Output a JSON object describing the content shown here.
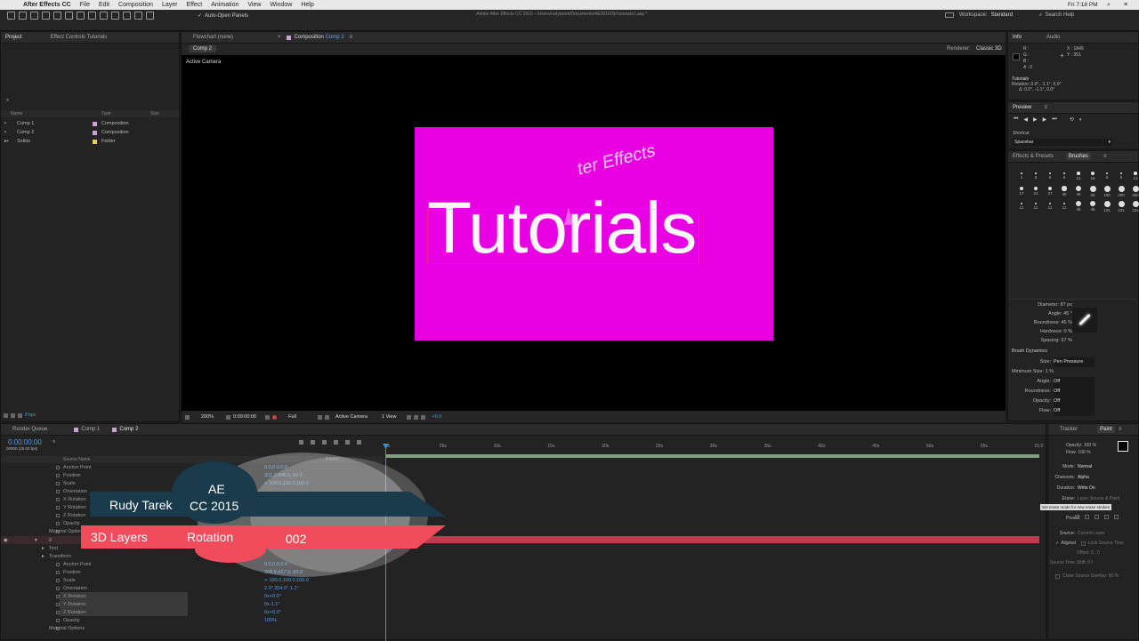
{
  "menubar": {
    "items": [
      "After Effects CC",
      "File",
      "Edit",
      "Composition",
      "Layer",
      "Effect",
      "Animation",
      "View",
      "Window",
      "Help"
    ],
    "clock": "Fri 7:18 PM"
  },
  "toolbar": {
    "auto_open": "Auto-Open Panels",
    "title": "Adobe After Effects CC 2015 - /Users/rudytarek/Documents/AE2016/3d tutorials1.aep *",
    "workspace_label": "Workspace:",
    "workspace_value": "Standard",
    "search": "Search Help"
  },
  "project": {
    "tab_project": "Project",
    "tab_effects": "Effect Controls Tutorials",
    "cols": [
      "Name",
      "Type",
      "Size"
    ],
    "items": [
      {
        "name": "Comp 1",
        "type": "Composition",
        "color": "#c9a4d4"
      },
      {
        "name": "Comp 2",
        "type": "Composition",
        "color": "#c9a4d4"
      },
      {
        "name": "Solids",
        "type": "Folder",
        "color": "#e6d24a"
      }
    ],
    "bpc": "8 bpc"
  },
  "comp": {
    "tab_flowchart": "Flowchart (none)",
    "tab_comp_prefix": "Composition",
    "tab_comp_name": "Comp 2",
    "renderer_label": "Renderer:",
    "renderer_value": "Classic 3D",
    "breadcrumb": "Comp 2",
    "camera": "Active Camera",
    "title_text": "Tutorials",
    "subtitle_text": "ter Effects",
    "bg_color": "#e800e3",
    "zoom": "200%",
    "timecode": "0:00:00:00",
    "resolution": "Full",
    "view_camera": "Active Camera",
    "views": "1 View",
    "exposure": "+0.0"
  },
  "info": {
    "tab_info": "Info",
    "tab_audio": "Audio",
    "r": "R :",
    "g": "G :",
    "b": "B :",
    "a": "A : 0",
    "x": "X : 1849",
    "y": "Y : 351",
    "layer": "Tutorials",
    "rotation": "Rotation: 0.0°, -1.1°, 0.0°",
    "delta": "Δ: 0.0°, -1.1°, 0.0°"
  },
  "preview": {
    "title": "Preview",
    "shortcut_label": "Shortcut",
    "shortcut_value": "Spacebar"
  },
  "brushes": {
    "tab_effects": "Effects & Presets",
    "tab_brushes": "Brushes",
    "sizes": [
      "1",
      "3",
      "5",
      "9",
      "13",
      "19",
      "5",
      "9",
      "13",
      "17",
      "21",
      "27",
      "35",
      "45",
      "65",
      "100",
      "200",
      "300",
      "11",
      "11",
      "11",
      "11",
      "45",
      "45",
      "131",
      "131",
      "131"
    ],
    "diameter": "Diameter: 87 px",
    "angle": "Angle: 45 °",
    "roundness": "Roundness: 45 %",
    "hardness": "Hardness: 0 %",
    "spacing": "Spacing: 57 %",
    "dynamics_title": "Brush Dynamics",
    "size_label": "Size:",
    "size_value": "Pen Pressure",
    "minsize": "Minimum Size: 1 %",
    "angle_label": "Angle:",
    "angle_value": "Off",
    "round_label": "Roundness:",
    "round_value": "Off",
    "opacity_label": "Opacity:",
    "opacity_value": "Off",
    "flow_label": "Flow:",
    "flow_value": "Off"
  },
  "timeline": {
    "tab_render": "Render Queue",
    "tab_comp1": "Comp 1",
    "tab_comp2": "Comp 2",
    "timecode": "0:00:00:00",
    "fps": "00000 (25.00 fps)",
    "col_source": "Source Name",
    "col_parent": "Parent",
    "ruler": [
      "0s",
      "05s",
      "10s",
      "15s",
      "20s",
      "25s",
      "30s",
      "35s",
      "40s",
      "45s",
      "50s",
      "55s",
      "01:0"
    ],
    "props_top": [
      "Anchor Point",
      "Position",
      "Scale",
      "Orientation",
      "X Rotation",
      "Y Rotation",
      "Z Rotation",
      "Opacity",
      "Material Options"
    ],
    "vals_top": [
      "0.0,0.0,0.0",
      "331.2,448.5,-81.2",
      "∞ 100.0,100.0,100.0",
      "",
      "",
      "",
      "",
      "",
      ""
    ],
    "layer2_num": "2",
    "layer2_sub": [
      "Text",
      "Transform"
    ],
    "props_bottom": [
      "Anchor Point",
      "Position",
      "Scale",
      "Orientation",
      "X Rotation",
      "Y Rotation",
      "Z Rotation",
      "Opacity",
      "Material Options"
    ],
    "vals_bottom": [
      "0.0,0.0,0.0",
      "308.8,427.9,-83.8",
      "∞ 100.0,100.0,100.0",
      "2.3°,354.6°,1.1°",
      "0x+0.0°",
      "0x-1.1°",
      "0x+0.0°",
      "100%",
      ""
    ]
  },
  "overlay": {
    "name": "Rudy Tarek",
    "app": "AE",
    "version": "CC 2015",
    "topic": "3D Layers",
    "detail": "Rotation",
    "episode": "002"
  },
  "paint": {
    "tab_tracker": "Tracker",
    "tab_paint": "Paint",
    "opacity": "Opacity: 100 %",
    "flow": "Flow: 100 %",
    "mode_label": "Mode:",
    "mode_value": "Normal",
    "channels_label": "Channels:",
    "channels_value": "Alpha",
    "duration_label": "Duration:",
    "duration_value": "Write On",
    "erase_label": "Erase:",
    "erase_value": "Layer Source & Paint",
    "tooltip": "Set erase mode for new erase strokes",
    "preset_label": "Preset:",
    "source_label": "Source:",
    "source_value": "Current Layer",
    "aligned": "Aligned",
    "lock": "Lock Source Time",
    "offset": "Offset: 0 , 0",
    "shift": "Source Time Shift: 0 f",
    "clone": "Clone Source Overlay: 50 %"
  }
}
